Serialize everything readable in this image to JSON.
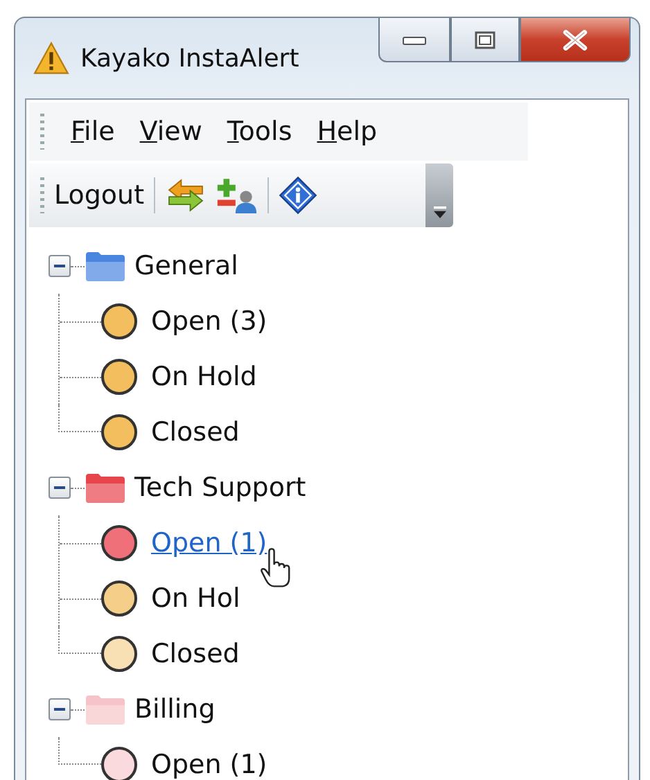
{
  "window": {
    "title": "Kayako InstaAlert"
  },
  "menu": [
    {
      "label": "File"
    },
    {
      "label": "View"
    },
    {
      "label": "Tools"
    },
    {
      "label": "Help"
    }
  ],
  "toolbar": [
    {
      "kind": "text",
      "label": "Logout"
    },
    {
      "kind": "separator"
    },
    {
      "kind": "swap"
    },
    {
      "kind": "users"
    },
    {
      "kind": "separator"
    },
    {
      "kind": "info"
    }
  ],
  "tree": [
    {
      "label": "General",
      "color": "#4a86e0",
      "expanded": true,
      "children": [
        {
          "label": "Open (3)",
          "color": "#f3be5e",
          "hovered": false
        },
        {
          "label": "On Hold",
          "color": "#f3be5e",
          "hovered": false
        },
        {
          "label": "Closed",
          "color": "#f3be5e",
          "hovered": false
        }
      ]
    },
    {
      "label": "Tech Support",
      "color": "#e8444c",
      "expanded": true,
      "children": [
        {
          "label": "Open (1)",
          "color": "#f0707a",
          "hovered": true
        },
        {
          "label": "On Hol",
          "color": "#f5cf8a",
          "hovered": false
        },
        {
          "label": "Closed",
          "color": "#f8e0b4",
          "hovered": false
        }
      ]
    },
    {
      "label": "Billing",
      "color": "#f6c4c8",
      "expanded": true,
      "children": [
        {
          "label": "Open (1)",
          "color": "#fadadd",
          "hovered": false
        }
      ]
    }
  ]
}
